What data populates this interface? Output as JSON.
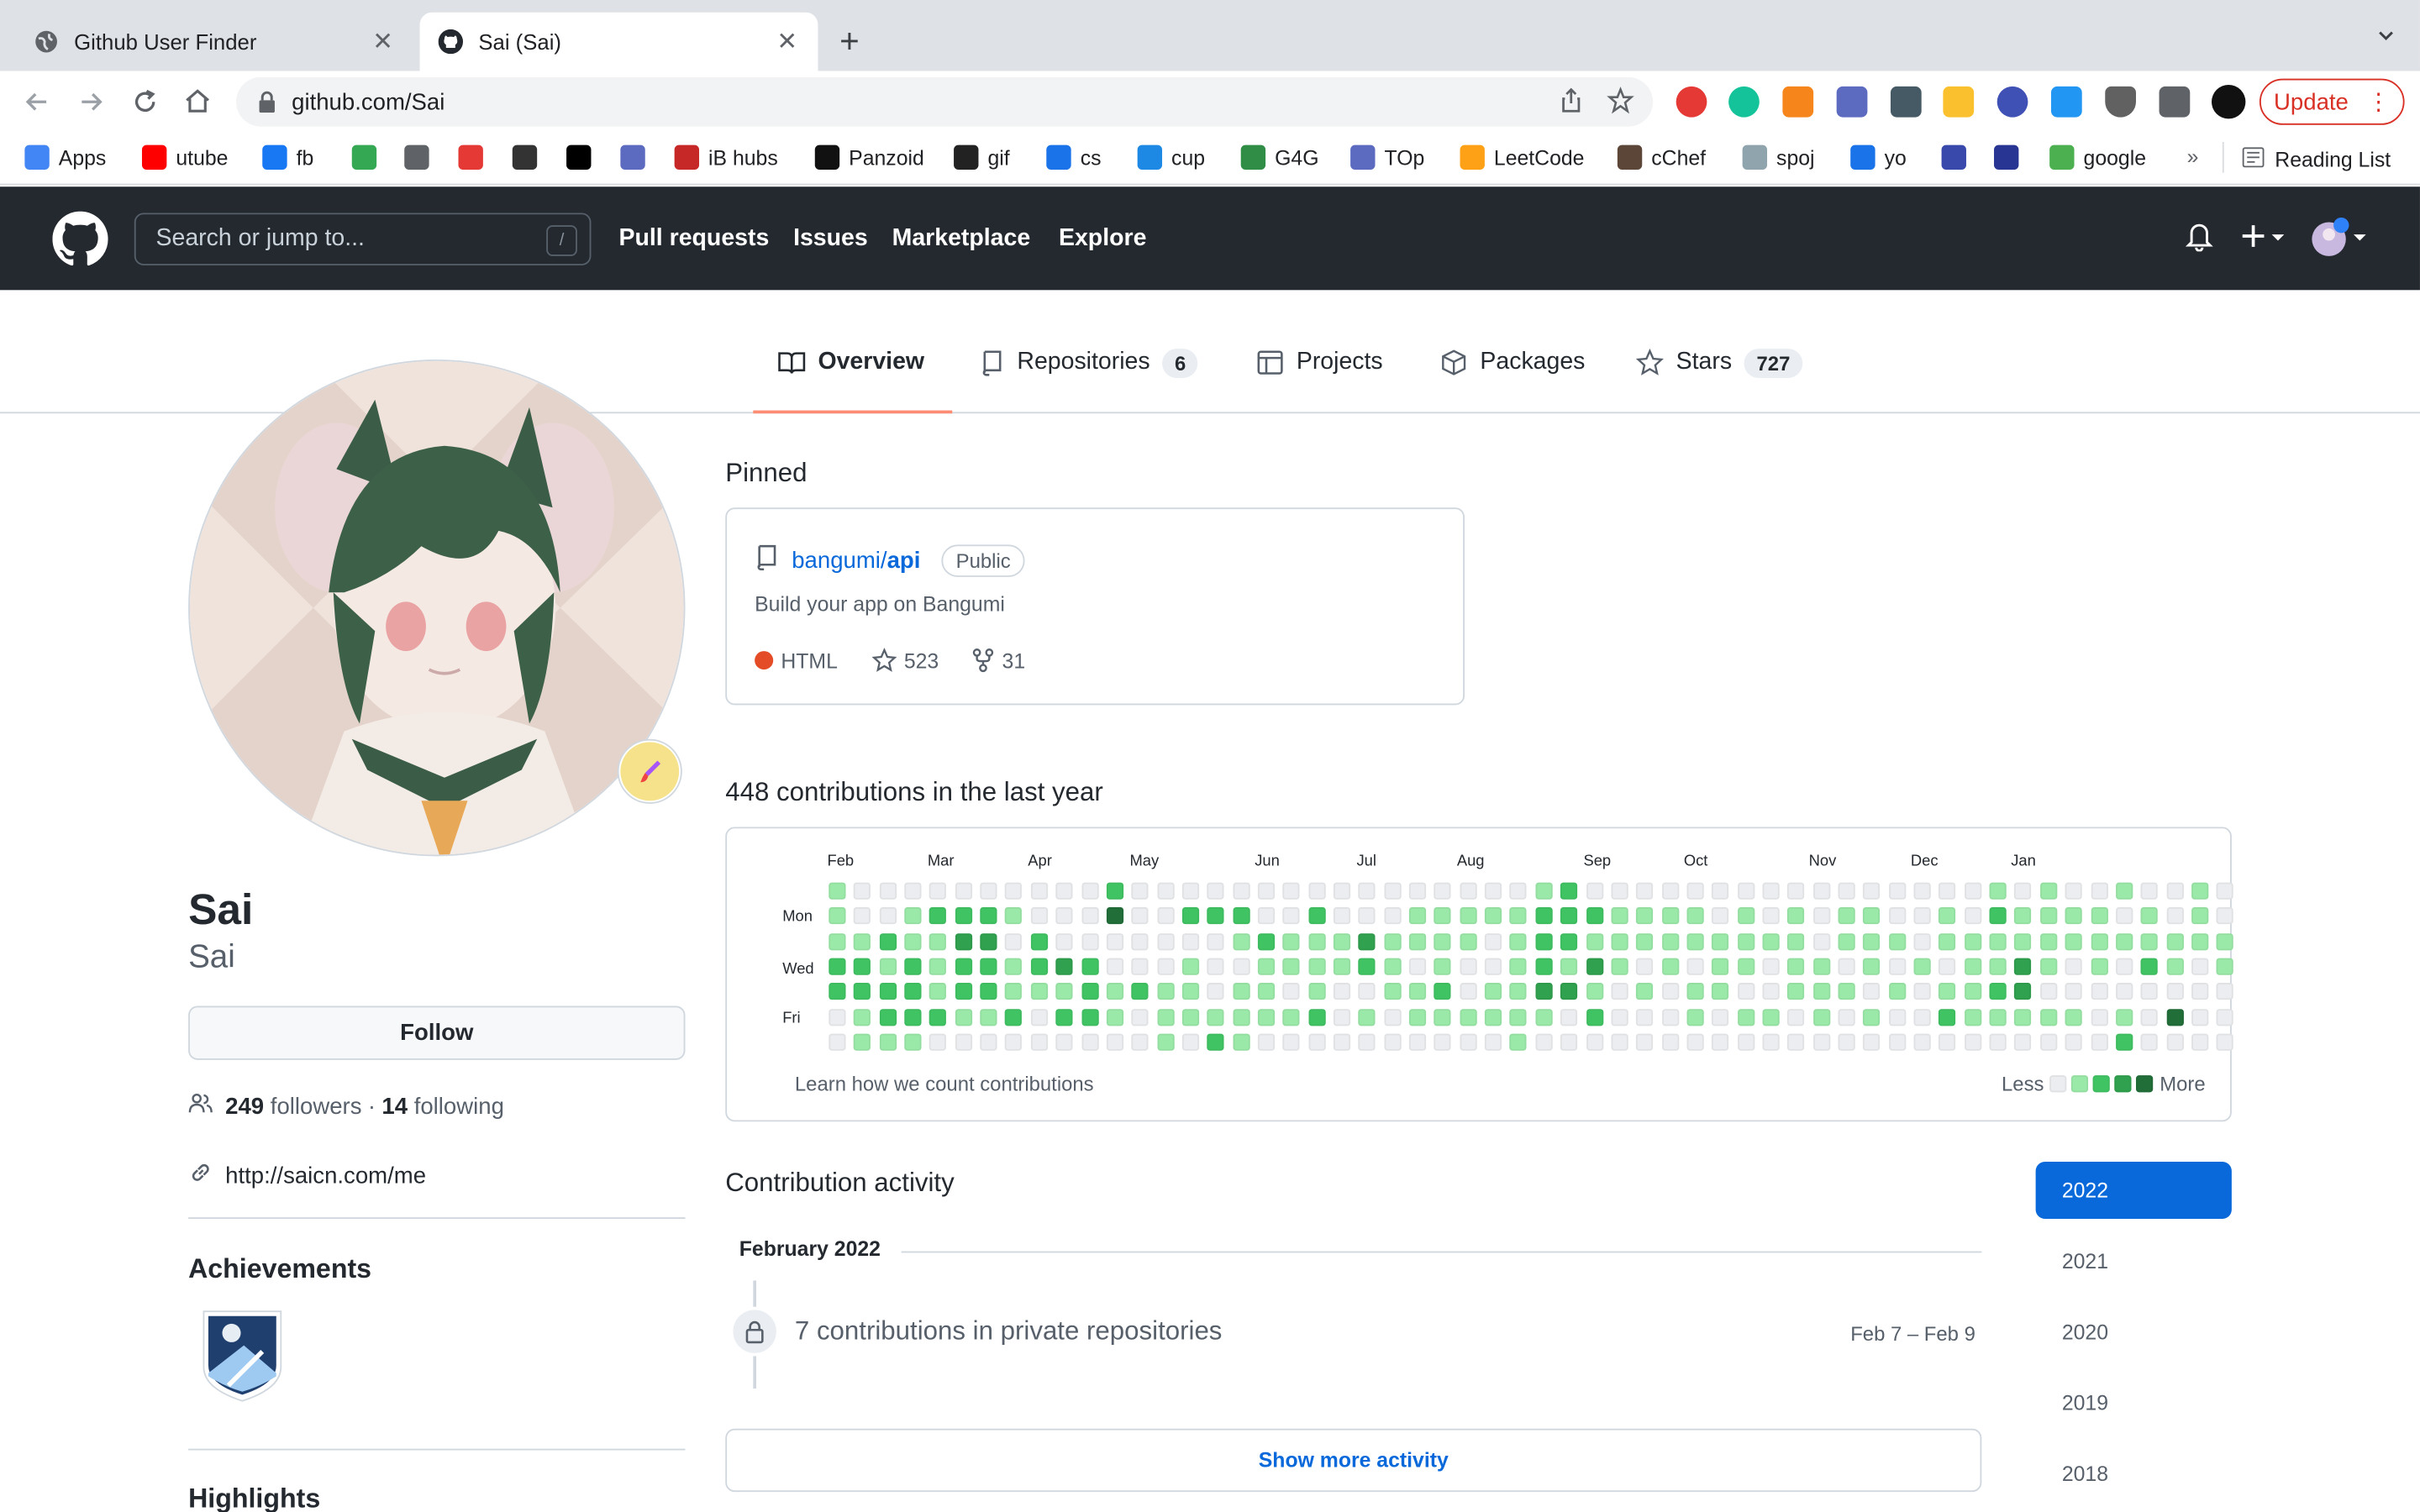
{
  "browser": {
    "tabs": [
      {
        "title": "Github User Finder"
      },
      {
        "title": "Sai (Sai)"
      }
    ],
    "url": "github.com/Sai",
    "update_label": "Update"
  },
  "bookmarks": [
    {
      "label": "Apps",
      "color": "#4285f4"
    },
    {
      "label": "utube",
      "color": "#ff0000"
    },
    {
      "label": "fb",
      "color": "#1877f2"
    },
    {
      "label": "",
      "color": "#34a853"
    },
    {
      "label": "",
      "color": "#5f6368"
    },
    {
      "label": "",
      "color": "#e53935"
    },
    {
      "label": "",
      "color": "#333333"
    },
    {
      "label": "",
      "color": "#000000"
    },
    {
      "label": "",
      "color": "#5c6bc0"
    },
    {
      "label": "iB hubs",
      "color": "#c62828"
    },
    {
      "label": "Panzoid",
      "color": "#111111"
    },
    {
      "label": "gif",
      "color": "#222222"
    },
    {
      "label": "cs",
      "color": "#1a73e8"
    },
    {
      "label": "cup",
      "color": "#1e88e5"
    },
    {
      "label": "G4G",
      "color": "#2f8d46"
    },
    {
      "label": "TOp",
      "color": "#5c6bc0"
    },
    {
      "label": "LeetCode",
      "color": "#ffa116"
    },
    {
      "label": "cChef",
      "color": "#5b4638"
    },
    {
      "label": "spoj",
      "color": "#90a4ae"
    },
    {
      "label": "yo",
      "color": "#1a73e8"
    },
    {
      "label": "",
      "color": "#3949ab"
    },
    {
      "label": "",
      "color": "#283593"
    },
    {
      "label": "google",
      "color": "#4caf50"
    }
  ],
  "reading_list": "Reading List",
  "github": {
    "search_placeholder": "Search or jump to...",
    "search_key": "/",
    "nav": [
      "Pull requests",
      "Issues",
      "Marketplace",
      "Explore"
    ]
  },
  "profile_tabs": [
    {
      "label": "Overview",
      "count": null
    },
    {
      "label": "Repositories",
      "count": "6"
    },
    {
      "label": "Projects",
      "count": null
    },
    {
      "label": "Packages",
      "count": null
    },
    {
      "label": "Stars",
      "count": "727"
    }
  ],
  "profile": {
    "name": "Sai",
    "login": "Sai",
    "follow_label": "Follow",
    "followers": "249",
    "followers_label": "followers",
    "separator": "·",
    "following": "14",
    "following_label": "following",
    "website": "http://saicn.com/me",
    "achievements_title": "Achievements",
    "highlights_title": "Highlights"
  },
  "pinned": {
    "title": "Pinned",
    "repo_owner": "bangumi/",
    "repo_name": "api",
    "visibility": "Public",
    "description": "Build your app on Bangumi",
    "language": "HTML",
    "language_color": "#e34c26",
    "stars": "523",
    "forks": "31"
  },
  "contributions": {
    "title": "448 contributions in the last year",
    "months": [
      "Feb",
      "Mar",
      "Apr",
      "May",
      "Jun",
      "Jul",
      "Aug",
      "Sep",
      "Oct",
      "Nov",
      "Dec",
      "Jan"
    ],
    "days": [
      "Mon",
      "Wed",
      "Fri"
    ],
    "learn_label": "Learn how we count contributions",
    "less_label": "Less",
    "more_label": "More",
    "level_colors": [
      "#ebedf0",
      "#9be9a8",
      "#40c463",
      "#30a14e",
      "#216e39"
    ],
    "weeks": [
      [
        1,
        1,
        1,
        2,
        2,
        0,
        0
      ],
      [
        0,
        0,
        1,
        2,
        2,
        1,
        1
      ],
      [
        0,
        0,
        2,
        1,
        2,
        2,
        1
      ],
      [
        0,
        1,
        1,
        2,
        2,
        2,
        1
      ],
      [
        0,
        2,
        1,
        1,
        1,
        2,
        0
      ],
      [
        0,
        2,
        3,
        2,
        2,
        1,
        0
      ],
      [
        0,
        2,
        3,
        2,
        2,
        1,
        0
      ],
      [
        0,
        1,
        0,
        1,
        1,
        2,
        0
      ],
      [
        0,
        0,
        2,
        2,
        1,
        0,
        0
      ],
      [
        0,
        0,
        0,
        3,
        1,
        2,
        0
      ],
      [
        0,
        0,
        0,
        2,
        2,
        2,
        0
      ],
      [
        2,
        4,
        0,
        0,
        1,
        1,
        0
      ],
      [
        0,
        0,
        0,
        0,
        2,
        0,
        0
      ],
      [
        0,
        0,
        0,
        0,
        1,
        1,
        1
      ],
      [
        0,
        2,
        0,
        1,
        1,
        1,
        0
      ],
      [
        0,
        2,
        0,
        0,
        0,
        1,
        2
      ],
      [
        0,
        2,
        1,
        0,
        1,
        1,
        1
      ],
      [
        0,
        0,
        2,
        1,
        1,
        1,
        0
      ],
      [
        0,
        0,
        1,
        1,
        0,
        1,
        0
      ],
      [
        0,
        2,
        1,
        1,
        1,
        2,
        0
      ],
      [
        0,
        0,
        1,
        1,
        0,
        0,
        0
      ],
      [
        0,
        0,
        3,
        2,
        0,
        1,
        0
      ],
      [
        0,
        0,
        1,
        1,
        1,
        0,
        0
      ],
      [
        0,
        1,
        1,
        0,
        1,
        1,
        0
      ],
      [
        0,
        1,
        1,
        1,
        2,
        1,
        0
      ],
      [
        0,
        1,
        1,
        0,
        0,
        1,
        0
      ],
      [
        0,
        1,
        0,
        0,
        1,
        1,
        0
      ],
      [
        0,
        1,
        1,
        1,
        1,
        1,
        1
      ],
      [
        1,
        2,
        2,
        2,
        3,
        1,
        0
      ],
      [
        2,
        2,
        2,
        1,
        3,
        0,
        0
      ],
      [
        0,
        2,
        1,
        3,
        1,
        2,
        0
      ],
      [
        0,
        1,
        1,
        1,
        0,
        0,
        0
      ],
      [
        0,
        1,
        1,
        0,
        1,
        0,
        0
      ],
      [
        0,
        1,
        1,
        1,
        0,
        0,
        0
      ],
      [
        0,
        1,
        1,
        0,
        1,
        1,
        0
      ],
      [
        0,
        0,
        1,
        1,
        1,
        0,
        0
      ],
      [
        0,
        1,
        1,
        1,
        0,
        1,
        0
      ],
      [
        0,
        0,
        1,
        0,
        0,
        1,
        0
      ],
      [
        0,
        1,
        1,
        1,
        1,
        0,
        0
      ],
      [
        0,
        0,
        0,
        1,
        1,
        1,
        0
      ],
      [
        0,
        1,
        1,
        0,
        1,
        0,
        0
      ],
      [
        0,
        1,
        1,
        1,
        0,
        1,
        0
      ],
      [
        0,
        0,
        1,
        0,
        1,
        0,
        0
      ],
      [
        0,
        0,
        0,
        1,
        0,
        0,
        0
      ],
      [
        0,
        1,
        1,
        0,
        1,
        2,
        0
      ],
      [
        0,
        0,
        1,
        1,
        1,
        1,
        0
      ],
      [
        1,
        2,
        1,
        1,
        2,
        1,
        0
      ],
      [
        0,
        1,
        1,
        3,
        3,
        1,
        0
      ],
      [
        1,
        1,
        1,
        1,
        0,
        1,
        0
      ],
      [
        0,
        1,
        1,
        0,
        0,
        1,
        0
      ],
      [
        0,
        1,
        1,
        1,
        0,
        0,
        0
      ],
      [
        1,
        0,
        1,
        0,
        0,
        1,
        2
      ],
      [
        0,
        1,
        1,
        2,
        0,
        0,
        0
      ],
      [
        0,
        0,
        1,
        1,
        0,
        4,
        0
      ],
      [
        1,
        1,
        1,
        0,
        0,
        0,
        0
      ],
      [
        0,
        0,
        1,
        1,
        0,
        0,
        0
      ]
    ]
  },
  "activity": {
    "title": "Contribution activity",
    "month": "February 2022",
    "item_text": "7 contributions in private repositories",
    "item_date": "Feb 7 – Feb 9",
    "show_more": "Show more activity",
    "years": [
      "2022",
      "2021",
      "2020",
      "2019",
      "2018"
    ]
  }
}
